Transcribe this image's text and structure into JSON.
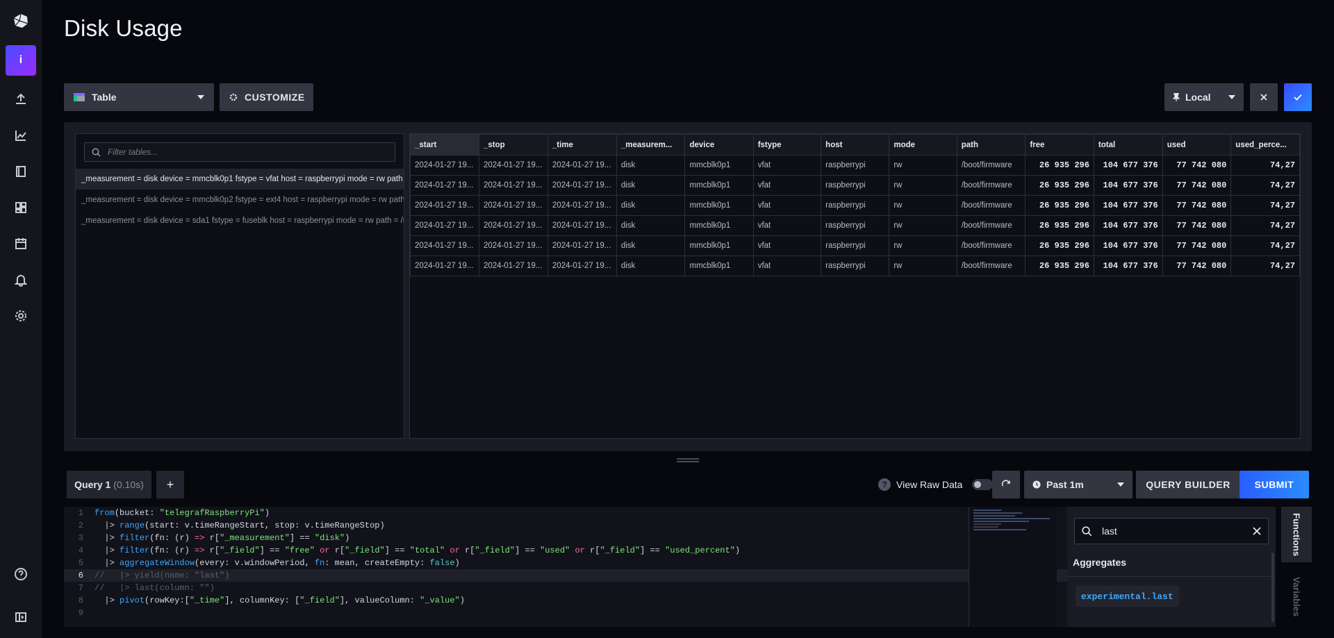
{
  "page": {
    "title": "Disk Usage"
  },
  "sidebar": {
    "active_label": "i",
    "icons": [
      "upload-icon",
      "chart-line-icon",
      "notebook-icon",
      "dashboard-icon",
      "calendar-icon",
      "bell-icon",
      "gear-icon"
    ],
    "bottom_icons": [
      "help-icon",
      "collapse-icon"
    ]
  },
  "toolbar": {
    "viz_type": "Table",
    "customize_label": "CUSTOMIZE",
    "timezone": "Local"
  },
  "tables_panel": {
    "filter_placeholder": "Filter tables...",
    "series": [
      "_measurement = disk device = mmcblk0p1 fstype = vfat host = raspberrypi mode = rw path = /boot/firmware",
      "_measurement = disk device = mmcblk0p2 fstype = ext4 host = raspberrypi mode = rw path = /",
      "_measurement = disk device = sda1 fstype = fuseblk host = raspberrypi mode = rw path = /media"
    ]
  },
  "data_table": {
    "columns": [
      "_start",
      "_stop",
      "_time",
      "_measurem...",
      "device",
      "fstype",
      "host",
      "mode",
      "path",
      "free",
      "total",
      "used",
      "used_perce..."
    ],
    "rows": [
      [
        "2024-01-27 19...",
        "2024-01-27 19...",
        "2024-01-27 19...",
        "disk",
        "mmcblk0p1",
        "vfat",
        "raspberrypi",
        "rw",
        "/boot/firmware",
        "26 935 296",
        "104 677 376",
        "77 742 080",
        "74,27"
      ],
      [
        "2024-01-27 19...",
        "2024-01-27 19...",
        "2024-01-27 19...",
        "disk",
        "mmcblk0p1",
        "vfat",
        "raspberrypi",
        "rw",
        "/boot/firmware",
        "26 935 296",
        "104 677 376",
        "77 742 080",
        "74,27"
      ],
      [
        "2024-01-27 19...",
        "2024-01-27 19...",
        "2024-01-27 19...",
        "disk",
        "mmcblk0p1",
        "vfat",
        "raspberrypi",
        "rw",
        "/boot/firmware",
        "26 935 296",
        "104 677 376",
        "77 742 080",
        "74,27"
      ],
      [
        "2024-01-27 19...",
        "2024-01-27 19...",
        "2024-01-27 19...",
        "disk",
        "mmcblk0p1",
        "vfat",
        "raspberrypi",
        "rw",
        "/boot/firmware",
        "26 935 296",
        "104 677 376",
        "77 742 080",
        "74,27"
      ],
      [
        "2024-01-27 19...",
        "2024-01-27 19...",
        "2024-01-27 19...",
        "disk",
        "mmcblk0p1",
        "vfat",
        "raspberrypi",
        "rw",
        "/boot/firmware",
        "26 935 296",
        "104 677 376",
        "77 742 080",
        "74,27"
      ],
      [
        "2024-01-27 19...",
        "2024-01-27 19...",
        "2024-01-27 19...",
        "disk",
        "mmcblk0p1",
        "vfat",
        "raspberrypi",
        "rw",
        "/boot/firmware",
        "26 935 296",
        "104 677 376",
        "77 742 080",
        "74,27"
      ]
    ]
  },
  "query_bar": {
    "query_label": "Query 1",
    "query_time": "(0.10s)",
    "add_label": "+",
    "raw_data_label": "View Raw Data",
    "time_range": "Past 1m",
    "query_builder_label": "QUERY BUILDER",
    "submit_label": "SUBMIT"
  },
  "editor": {
    "lines": [
      [
        [
          "kw",
          "from"
        ],
        [
          "plain",
          "(bucket: "
        ],
        [
          "str",
          "\"telegrafRaspberryPi\""
        ],
        [
          "plain",
          ")"
        ]
      ],
      [
        [
          "plain",
          "  |> "
        ],
        [
          "kw",
          "range"
        ],
        [
          "plain",
          "(start: v.timeRangeStart, stop: v.timeRangeStop)"
        ]
      ],
      [
        [
          "plain",
          "  |> "
        ],
        [
          "kw",
          "filter"
        ],
        [
          "plain",
          "(fn: (r) "
        ],
        [
          "op",
          "=>"
        ],
        [
          "plain",
          " r["
        ],
        [
          "str",
          "\"_measurement\""
        ],
        [
          "plain",
          "] == "
        ],
        [
          "str",
          "\"disk\""
        ],
        [
          "plain",
          ")"
        ]
      ],
      [
        [
          "plain",
          "  |> "
        ],
        [
          "kw",
          "filter"
        ],
        [
          "plain",
          "(fn: (r) "
        ],
        [
          "op",
          "=>"
        ],
        [
          "plain",
          " r["
        ],
        [
          "str",
          "\"_field\""
        ],
        [
          "plain",
          "] == "
        ],
        [
          "str",
          "\"free\""
        ],
        [
          "plain",
          " "
        ],
        [
          "op",
          "or"
        ],
        [
          "plain",
          " r["
        ],
        [
          "str",
          "\"_field\""
        ],
        [
          "plain",
          "] == "
        ],
        [
          "str",
          "\"total\""
        ],
        [
          "plain",
          " "
        ],
        [
          "op",
          "or"
        ],
        [
          "plain",
          " r["
        ],
        [
          "str",
          "\"_field\""
        ],
        [
          "plain",
          "] == "
        ],
        [
          "str",
          "\"used\""
        ],
        [
          "plain",
          " "
        ],
        [
          "op",
          "or"
        ],
        [
          "plain",
          " r["
        ],
        [
          "str",
          "\"_field\""
        ],
        [
          "plain",
          "] == "
        ],
        [
          "str",
          "\"used_percent\""
        ],
        [
          "plain",
          ")"
        ]
      ],
      [
        [
          "plain",
          "  |> "
        ],
        [
          "kw",
          "aggregateWindow"
        ],
        [
          "plain",
          "(every: v.windowPeriod, "
        ],
        [
          "kw",
          "fn"
        ],
        [
          "plain",
          ": mean, createEmpty: "
        ],
        [
          "bool",
          "false"
        ],
        [
          "plain",
          ")"
        ]
      ],
      [
        [
          "comment",
          "//   |> yield(name: \"last\")"
        ]
      ],
      [
        [
          "comment",
          "//   |> last(column: \"\")"
        ]
      ],
      [
        [
          "plain",
          "  |> "
        ],
        [
          "kw",
          "pivot"
        ],
        [
          "plain",
          "(rowKey:["
        ],
        [
          "str",
          "\"_time\""
        ],
        [
          "plain",
          "], columnKey: ["
        ],
        [
          "str",
          "\"_field\""
        ],
        [
          "plain",
          "], valueColumn: "
        ],
        [
          "str",
          "\"_value\""
        ],
        [
          "plain",
          ")"
        ]
      ],
      []
    ],
    "current_line": 6
  },
  "functions_panel": {
    "search_value": "last",
    "heading": "Aggregates",
    "items": [
      "experimental.last"
    ],
    "tabs": [
      "Functions",
      "Variables"
    ]
  }
}
